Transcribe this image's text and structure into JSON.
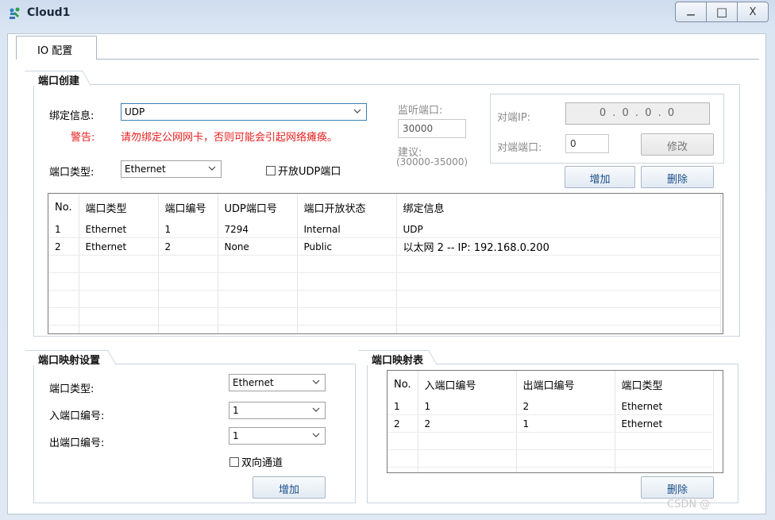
{
  "window": {
    "title": "Cloud1",
    "min": "—",
    "max": "□",
    "close": "X"
  },
  "tabs": [
    {
      "label": "IO 配置"
    }
  ],
  "port_create": {
    "title": "端口创建",
    "binding_label": "绑定信息:",
    "binding_value": "UDP",
    "warning_label": "警告:",
    "warning_text": "请勿绑定公网网卡，否则可能会引起网络瘫痪。",
    "port_type_label": "端口类型:",
    "port_type_value": "Ethernet",
    "open_udp_label": "开放UDP端口",
    "listen_port_label": "监听端口:",
    "listen_port_value": "30000",
    "suggest_label": "建议:",
    "suggest_range": "(30000-35000)",
    "peer_ip_label": "对端IP:",
    "peer_ip_value": "0 . 0 . 0 . 0",
    "peer_port_label": "对端端口:",
    "peer_port_value": "0",
    "modify_label": "修改",
    "add_label": "增加",
    "delete_label": "删除",
    "table": {
      "headers": [
        "No.",
        "端口类型",
        "端口编号",
        "UDP端口号",
        "端口开放状态",
        "绑定信息"
      ],
      "rows": [
        [
          "1",
          "Ethernet",
          "1",
          "7294",
          "Internal",
          "UDP"
        ],
        [
          "2",
          "Ethernet",
          "2",
          "None",
          "Public",
          "以太网 2 -- IP: 192.168.0.200"
        ]
      ]
    }
  },
  "port_map_settings": {
    "title": "端口映射设置",
    "port_type_label": "端口类型:",
    "port_type_value": "Ethernet",
    "in_port_label": "入端口编号:",
    "in_port_value": "1",
    "out_port_label": "出端口编号:",
    "out_port_value": "1",
    "bidirectional_label": "双向通道",
    "add_label": "增加"
  },
  "port_map_table": {
    "title": "端口映射表",
    "headers": [
      "No.",
      "入端口编号",
      "出端口编号",
      "端口类型"
    ],
    "rows": [
      [
        "1",
        "1",
        "2",
        "Ethernet"
      ],
      [
        "2",
        "2",
        "1",
        "Ethernet"
      ]
    ],
    "delete_label": "删除"
  },
  "watermark": "CSDN @"
}
